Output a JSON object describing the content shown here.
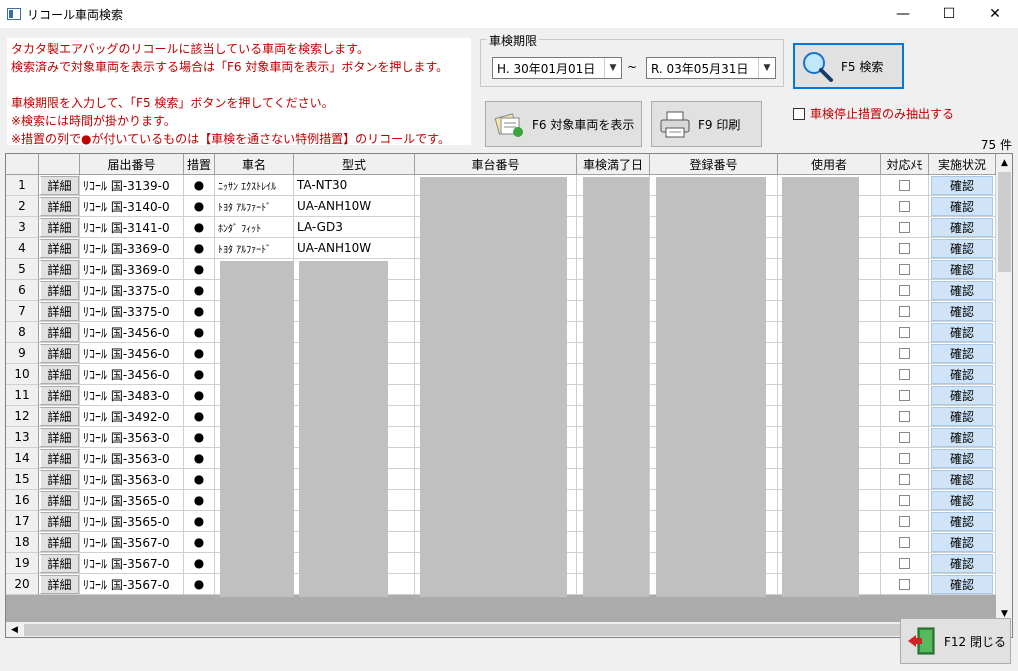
{
  "window": {
    "title": "リコール車両検索",
    "minimize": "—",
    "maximize": "☐",
    "close": "✕"
  },
  "info": {
    "line1": "タカタ製エアバッグのリコールに該当している車両を検索します。",
    "line2": "検索済みで対象車両を表示する場合は「F6 対象車両を表示」ボタンを押します。",
    "line3": "",
    "line4": "車検期限を入力して、「F5 検索」ボタンを押してください。",
    "line5": "※検索には時間が掛かります。",
    "line6": "※措置の列で●が付いているものは【車検を通さない特例措置】のリコールです。"
  },
  "period": {
    "label": "車検期限",
    "from": "H. 30年01月01日",
    "tilde": "~",
    "to": "R. 03年05月31日"
  },
  "buttons": {
    "search": "F5 検索",
    "show": "F6 対象車両を表示",
    "print": "F9 印刷",
    "close": "F12 閉じる"
  },
  "filter": {
    "stop_only": "車検停止措置のみ抽出する"
  },
  "count": "75 件",
  "grid": {
    "headers": [
      "",
      "",
      "届出番号",
      "措置",
      "車名",
      "型式",
      "車台番号",
      "車検満了日",
      "登録番号",
      "使用者",
      "対応ﾒﾓ",
      "実施状況"
    ],
    "detail_label": "詳細",
    "confirm_label": "確認",
    "rows": [
      {
        "no": "1",
        "notice": "ﾘｺｰﾙ 国-3139-0",
        "measure": "●",
        "name": "ﾆｯｻﾝ ｴｸｽﾄﾚｲﾙ",
        "model": "TA-NT30"
      },
      {
        "no": "2",
        "notice": "ﾘｺｰﾙ 国-3140-0",
        "measure": "●",
        "name": "ﾄﾖﾀ ｱﾙﾌｧｰﾄﾞ",
        "model": "UA-ANH10W"
      },
      {
        "no": "3",
        "notice": "ﾘｺｰﾙ 国-3141-0",
        "measure": "●",
        "name": "ﾎﾝﾀﾞ ﾌｨｯﾄ",
        "model": "LA-GD3"
      },
      {
        "no": "4",
        "notice": "ﾘｺｰﾙ 国-3369-0",
        "measure": "●",
        "name": "ﾄﾖﾀ ｱﾙﾌｧｰﾄﾞ",
        "model": "UA-ANH10W"
      },
      {
        "no": "5",
        "notice": "ﾘｺｰﾙ 国-3369-0",
        "measure": "●",
        "name": "",
        "model": ""
      },
      {
        "no": "6",
        "notice": "ﾘｺｰﾙ 国-3375-0",
        "measure": "●",
        "name": "",
        "model": ""
      },
      {
        "no": "7",
        "notice": "ﾘｺｰﾙ 国-3375-0",
        "measure": "●",
        "name": "",
        "model": ""
      },
      {
        "no": "8",
        "notice": "ﾘｺｰﾙ 国-3456-0",
        "measure": "●",
        "name": "",
        "model": ""
      },
      {
        "no": "9",
        "notice": "ﾘｺｰﾙ 国-3456-0",
        "measure": "●",
        "name": "",
        "model": ""
      },
      {
        "no": "10",
        "notice": "ﾘｺｰﾙ 国-3456-0",
        "measure": "●",
        "name": "",
        "model": ""
      },
      {
        "no": "11",
        "notice": "ﾘｺｰﾙ 国-3483-0",
        "measure": "●",
        "name": "",
        "model": ""
      },
      {
        "no": "12",
        "notice": "ﾘｺｰﾙ 国-3492-0",
        "measure": "●",
        "name": "",
        "model": ""
      },
      {
        "no": "13",
        "notice": "ﾘｺｰﾙ 国-3563-0",
        "measure": "●",
        "name": "",
        "model": ""
      },
      {
        "no": "14",
        "notice": "ﾘｺｰﾙ 国-3563-0",
        "measure": "●",
        "name": "",
        "model": ""
      },
      {
        "no": "15",
        "notice": "ﾘｺｰﾙ 国-3563-0",
        "measure": "●",
        "name": "",
        "model": ""
      },
      {
        "no": "16",
        "notice": "ﾘｺｰﾙ 国-3565-0",
        "measure": "●",
        "name": "",
        "model": ""
      },
      {
        "no": "17",
        "notice": "ﾘｺｰﾙ 国-3565-0",
        "measure": "●",
        "name": "",
        "model": ""
      },
      {
        "no": "18",
        "notice": "ﾘｺｰﾙ 国-3567-0",
        "measure": "●",
        "name": "",
        "model": ""
      },
      {
        "no": "19",
        "notice": "ﾘｺｰﾙ 国-3567-0",
        "measure": "●",
        "name": "",
        "model": ""
      },
      {
        "no": "20",
        "notice": "ﾘｺｰﾙ 国-3567-0",
        "measure": "●",
        "name": "",
        "model": ""
      }
    ]
  },
  "icons": {
    "search": "magnifier-icon",
    "show": "vehicle-list-icon",
    "print": "printer-icon",
    "close": "exit-door-icon"
  }
}
